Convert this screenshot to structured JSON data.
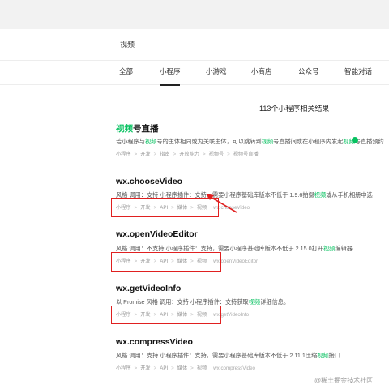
{
  "search": {
    "query": "视频"
  },
  "tabs": [
    "全部",
    "小程序",
    "小游戏",
    "小商店",
    "公众号",
    "智能对话"
  ],
  "result_count": "113个小程序相关结果",
  "results": [
    {
      "title_hl": "视频",
      "title_rest": "号直播",
      "desc_parts": [
        "若小程序与",
        "视频",
        "号的主体相同或为关联主体，可以跳转到",
        "视频",
        "号直播间或在小程序内发起",
        "视频",
        "号直播预约"
      ],
      "crumbs": [
        "小程序",
        "开发",
        "指南",
        "开放能力",
        "视频号",
        "视频号直播"
      ],
      "url": ""
    },
    {
      "title": "wx.chooseVideo",
      "desc_parts": [
        "风格 调用：支持 小程序插件：支持，需要小程序基础库版本不低于 1.9.6拍摄",
        "视频",
        "或从手机相册中选"
      ],
      "crumbs": [
        "小程序",
        "开发",
        "API",
        "媒体",
        "视频"
      ],
      "url": "wx.chooseVideo"
    },
    {
      "title": "wx.openVideoEditor",
      "desc_parts": [
        "风格 调用：不支持 小程序插件：支持，需要小程序基础库版本不低于 2.15.0打开",
        "视频",
        "编辑器"
      ],
      "crumbs": [
        "小程序",
        "开发",
        "API",
        "媒体",
        "视频"
      ],
      "url": "wx.openVideoEditor"
    },
    {
      "title": "wx.getVideoInfo",
      "desc_parts": [
        "以 Promise 风格 调用：支持 小程序插件：支持获取",
        "视频",
        "详细信息。"
      ],
      "crumbs": [
        "小程序",
        "开发",
        "API",
        "媒体",
        "视频"
      ],
      "url": "wx.getVideoInfo"
    },
    {
      "title": "wx.compressVideo",
      "desc_parts": [
        "风格 调用：支持 小程序插件：支持，需要小程序基础库版本不低于 2.11.1压缩",
        "视频",
        "接口"
      ],
      "crumbs": [
        "小程序",
        "开发",
        "API",
        "媒体",
        "视频"
      ],
      "url": "wx.compressVideo"
    }
  ],
  "watermark": "@稀土掘金技术社区",
  "colors": {
    "highlight": "#07c160",
    "annotation": "#e02020"
  }
}
